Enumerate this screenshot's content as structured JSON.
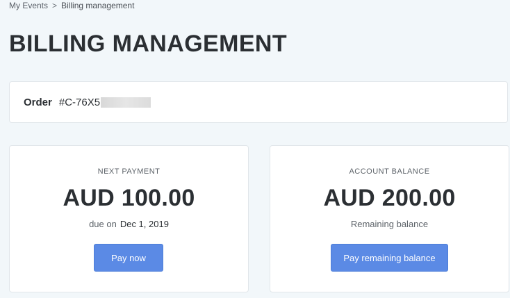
{
  "breadcrumb": {
    "items": [
      "My Events",
      "Billing management"
    ],
    "separator": ">"
  },
  "page": {
    "title": "BILLING MANAGEMENT"
  },
  "order": {
    "label": "Order",
    "number_prefix": "#C-76X5"
  },
  "next_payment": {
    "label": "NEXT PAYMENT",
    "amount": "AUD 100.00",
    "due_prefix": "due on",
    "due_date": "Dec 1, 2019",
    "button_label": "Pay now"
  },
  "account_balance": {
    "label": "ACCOUNT BALANCE",
    "amount": "AUD 200.00",
    "sub_label": "Remaining balance",
    "button_label": "Pay remaining balance"
  },
  "colors": {
    "background": "#f2f7fa",
    "card": "#ffffff",
    "accent": "#5b8ae5",
    "text": "#2b2f33"
  }
}
